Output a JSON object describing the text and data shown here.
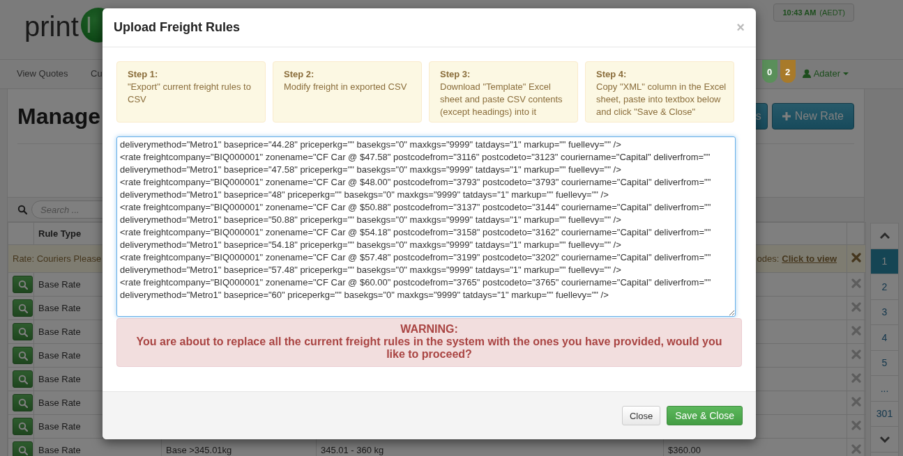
{
  "header": {
    "logo_text": "print",
    "logo_mark": "I",
    "clock": {
      "time": "10:43 AM",
      "zone": "(AEDT)"
    }
  },
  "nav": {
    "items": [
      {
        "label": "View Quotes"
      },
      {
        "label": "Cu"
      }
    ],
    "badges": [
      {
        "count": "0",
        "color": "#5a8f5a"
      },
      {
        "count": "2",
        "color": "#a87a2a"
      }
    ],
    "user": "Adater"
  },
  "page": {
    "title": "Manage",
    "buttons": [
      {
        "label": "s",
        "kind": "plain"
      },
      {
        "label": "New Rate",
        "kind": "add"
      }
    ],
    "search": {
      "placeholder": "Search ..."
    },
    "table": {
      "columns": [
        "Rule Type"
      ],
      "notice": {
        "text": "Rate: Couriers Please",
        "tail": "odes:",
        "link": "Click to view"
      },
      "rows": [
        {
          "rule_type": "Base Rate"
        },
        {
          "rule_type": "Base Rate"
        },
        {
          "rule_type": "Base Rate"
        },
        {
          "rule_type": "Base Rate"
        },
        {
          "rule_type": "Base Rate"
        },
        {
          "rule_type": "Base Rate"
        },
        {
          "rule_type": "Base Rate"
        },
        {
          "rule_type": "Base Rate",
          "column_3": "Base >345.01kg",
          "column_4": "345.01 - 360 kg",
          "column_5": "$360.00"
        }
      ]
    },
    "pagination": [
      {
        "label": "1",
        "selected": true
      },
      {
        "label": "2",
        "selected": false
      },
      {
        "label": "3",
        "selected": false
      },
      {
        "label": "4",
        "selected": false
      },
      {
        "label": "5",
        "selected": false
      },
      {
        "label": "...",
        "selected": false
      },
      {
        "label": "301",
        "selected": false
      }
    ]
  },
  "modal": {
    "title": "Upload Freight Rules",
    "close": "×",
    "steps": [
      {
        "title": "Step 1:",
        "text": "\"Export\" current freight rules to CSV"
      },
      {
        "title": "Step 2:",
        "text": "Modify freight in exported CSV"
      },
      {
        "title": "Step 3:",
        "text": "Download \"Template\" Excel sheet and paste CSV contents (except headings) into it"
      },
      {
        "title": "Step 4:",
        "text": "Copy \"XML\" column in the Excel sheet, paste into textbox below and click \"Save & Close\""
      }
    ],
    "xml": {
      "lines": [
        "deliverymethod=\"Metro1\" baseprice=\"44.28\" priceperkg=\"\" basekgs=\"0\" maxkgs=\"9999\" tatdays=\"1\" markup=\"\" fuellevy=\"\" />",
        "<rate freightcompany=\"BIQ000001\" zonename=\"CF Car @ $47.58\" postcodefrom=\"3116\" postcodeto=\"3123\" couriername=\"Capital\" deliverfrom=\"\"",
        "deliverymethod=\"Metro1\" baseprice=\"47.58\" priceperkg=\"\" basekgs=\"0\" maxkgs=\"9999\" tatdays=\"1\" markup=\"\" fuellevy=\"\" />",
        "<rate freightcompany=\"BIQ000001\" zonename=\"CF Car @ $48.00\" postcodefrom=\"3793\" postcodeto=\"3793\" couriername=\"Capital\" deliverfrom=\"\"",
        "deliverymethod=\"Metro1\" baseprice=\"48\" priceperkg=\"\" basekgs=\"0\" maxkgs=\"9999\" tatdays=\"1\" markup=\"\" fuellevy=\"\" />",
        "<rate freightcompany=\"BIQ000001\" zonename=\"CF Car @ $50.88\" postcodefrom=\"3137\" postcodeto=\"3144\" couriername=\"Capital\" deliverfrom=\"\"",
        "deliverymethod=\"Metro1\" baseprice=\"50.88\" priceperkg=\"\" basekgs=\"0\" maxkgs=\"9999\" tatdays=\"1\" markup=\"\" fuellevy=\"\" />",
        "<rate freightcompany=\"BIQ000001\" zonename=\"CF Car @ $54.18\" postcodefrom=\"3158\" postcodeto=\"3162\" couriername=\"Capital\" deliverfrom=\"\"",
        "deliverymethod=\"Metro1\" baseprice=\"54.18\" priceperkg=\"\" basekgs=\"0\" maxkgs=\"9999\" tatdays=\"1\" markup=\"\" fuellevy=\"\" />",
        "<rate freightcompany=\"BIQ000001\" zonename=\"CF Car @ $57.48\" postcodefrom=\"3199\" postcodeto=\"3202\" couriername=\"Capital\" deliverfrom=\"\"",
        "deliverymethod=\"Metro1\" baseprice=\"57.48\" priceperkg=\"\" basekgs=\"0\" maxkgs=\"9999\" tatdays=\"1\" markup=\"\" fuellevy=\"\" />",
        "<rate freightcompany=\"BIQ000001\" zonename=\"CF Car @ $60.00\" postcodefrom=\"3765\" postcodeto=\"3765\" couriername=\"Capital\" deliverfrom=\"\"",
        "deliverymethod=\"Metro1\" baseprice=\"60\" priceperkg=\"\" basekgs=\"0\" maxkgs=\"9999\" tatdays=\"1\" markup=\"\" fuellevy=\"\" />"
      ]
    },
    "warning": {
      "title": "WARNING:",
      "text": "You are about to replace all the current freight rules in the system with the ones you have provided, would you like to proceed?"
    },
    "buttons": [
      {
        "label": "Close",
        "kind": "default"
      },
      {
        "label": "Save & Close",
        "kind": "primary"
      }
    ]
  }
}
